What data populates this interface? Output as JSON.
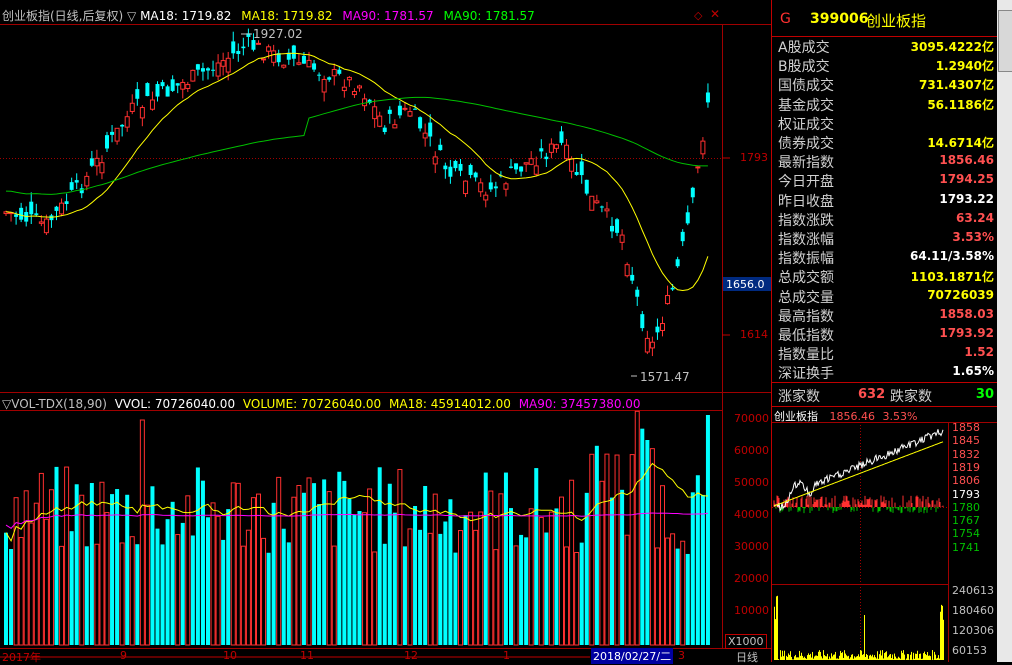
{
  "main_chart": {
    "title": "创业板指(日线,后复权)",
    "legend": [
      {
        "label": "MA18: 1719.82",
        "color": "#ffffff"
      },
      {
        "label": "MA18: 1719.82",
        "color": "#ffff00"
      },
      {
        "label": "MA90: 1781.57",
        "color": "#ff00ff"
      },
      {
        "label": "MA90: 1781.57",
        "color": "#00ff00"
      }
    ],
    "y_ticks": [
      "1793",
      "1656.0",
      "1614"
    ],
    "annotations": {
      "high": "1927.02",
      "low": "1571.47"
    }
  },
  "vol_chart": {
    "title": "VOL-TDX(18,90)",
    "legend": [
      {
        "label": "VVOL: 70726040.00",
        "color": "#ffffff"
      },
      {
        "label": "VOLUME: 70726040.00",
        "color": "#ffff00"
      },
      {
        "label": "MA18: 45914012.00",
        "color": "#ffff00"
      },
      {
        "label": "MA90: 37457380.00",
        "color": "#ff00ff"
      }
    ],
    "y_ticks": [
      "70000",
      "60000",
      "50000",
      "40000",
      "30000",
      "20000",
      "10000"
    ],
    "unit": "X1000"
  },
  "x_axis": {
    "labels": [
      "2017年",
      "9",
      "10",
      "11",
      "12",
      "1",
      "3",
      "日线"
    ],
    "highlight_date": "2018/02/27/二"
  },
  "right_panel": {
    "code_prefix": "G",
    "code": "399006",
    "name": "创业板指",
    "rows": [
      {
        "label": "A股成交",
        "value": "3095.4222亿",
        "color": "#ffff00"
      },
      {
        "label": "B股成交",
        "value": "1.2940亿",
        "color": "#ffff00"
      },
      {
        "label": "国债成交",
        "value": "731.4307亿",
        "color": "#ffff00"
      },
      {
        "label": "基金成交",
        "value": "56.1186亿",
        "color": "#ffff00"
      },
      {
        "label": "权证成交",
        "value": "",
        "color": "#ffff00"
      },
      {
        "label": "债券成交",
        "value": "14.6714亿",
        "color": "#ffff00"
      },
      {
        "label": "最新指数",
        "value": "1856.46",
        "color": "#ff5050"
      },
      {
        "label": "今日开盘",
        "value": "1794.25",
        "color": "#ff5050"
      },
      {
        "label": "昨日收盘",
        "value": "1793.22",
        "color": "#ffffff"
      },
      {
        "label": "指数涨跌",
        "value": "63.24",
        "color": "#ff5050"
      },
      {
        "label": "指数涨幅",
        "value": "3.53%",
        "color": "#ff5050"
      },
      {
        "label": "指数振幅",
        "value": "64.11/3.58%",
        "color": "#ffffff"
      },
      {
        "label": "总成交额",
        "value": "1103.1871亿",
        "color": "#ffff00"
      },
      {
        "label": "总成交量",
        "value": "70726039",
        "color": "#ffff00"
      },
      {
        "label": "最高指数",
        "value": "1858.03",
        "color": "#ff5050"
      },
      {
        "label": "最低指数",
        "value": "1793.92",
        "color": "#ff5050"
      },
      {
        "label": "指数量比",
        "value": "1.52",
        "color": "#ff5050"
      },
      {
        "label": "深证换手",
        "value": "1.65%",
        "color": "#ffffff"
      }
    ],
    "breadth": {
      "up_label": "涨家数",
      "up_value": "632",
      "down_label": "跌家数",
      "down_value": "30"
    },
    "mini": {
      "name": "创业板指",
      "price": "1856.46",
      "pct": "3.53%",
      "y_ticks": [
        "1858",
        "1845",
        "1832",
        "1819",
        "1806",
        "1793",
        "1780",
        "1767",
        "1754",
        "1741"
      ],
      "vol_ticks": [
        "240613",
        "180460",
        "120306",
        "60153"
      ]
    }
  }
}
